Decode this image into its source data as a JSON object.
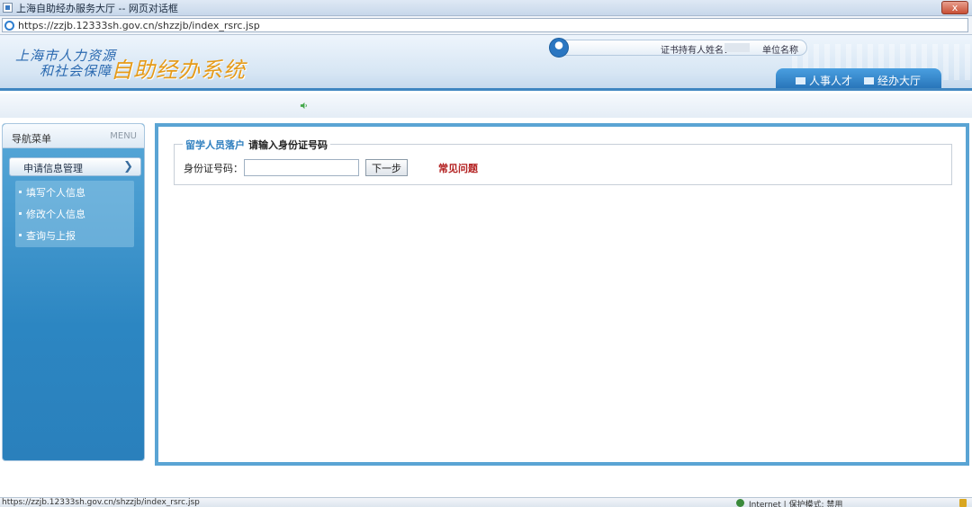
{
  "window": {
    "title": "上海自助经办服务大厅 -- 网页对话框",
    "close_label": "x"
  },
  "addressbar": {
    "url": "https://zzjb.12333sh.gov.cn/shzzjb/index_rsrc.jsp"
  },
  "header": {
    "logo_line1": "上海市人力资源",
    "logo_line2": "和社会保障",
    "system_name": "自助经办系统",
    "holder_label": "证书持有人姓名：",
    "unit_label": "单位名称",
    "tabs": [
      {
        "label": "人事人才",
        "icon": "document-icon"
      },
      {
        "label": "经办大厅",
        "icon": "building-icon"
      }
    ]
  },
  "sidebar": {
    "title": "导航菜单",
    "menu_label": "MENU",
    "main_item": "申请信息管理",
    "sub_items": [
      {
        "label": "填写个人信息"
      },
      {
        "label": "修改个人信息"
      },
      {
        "label": "查询与上报"
      }
    ]
  },
  "form": {
    "legend_title": "留学人员落户",
    "legend_prompt": "请输入身份证号码",
    "id_label": "身份证号码：",
    "id_value": "",
    "next_label": "下一步",
    "faq_label": "常见问题"
  },
  "statusbar": {
    "url": "https://zzjb.12333sh.gov.cn/shzzjb/index_rsrc.jsp",
    "zone": "Internet | 保护模式: 禁用"
  },
  "colors": {
    "accent_blue": "#3f86c1",
    "logo_orange": "#e59a18",
    "faq_red": "#b32020"
  }
}
